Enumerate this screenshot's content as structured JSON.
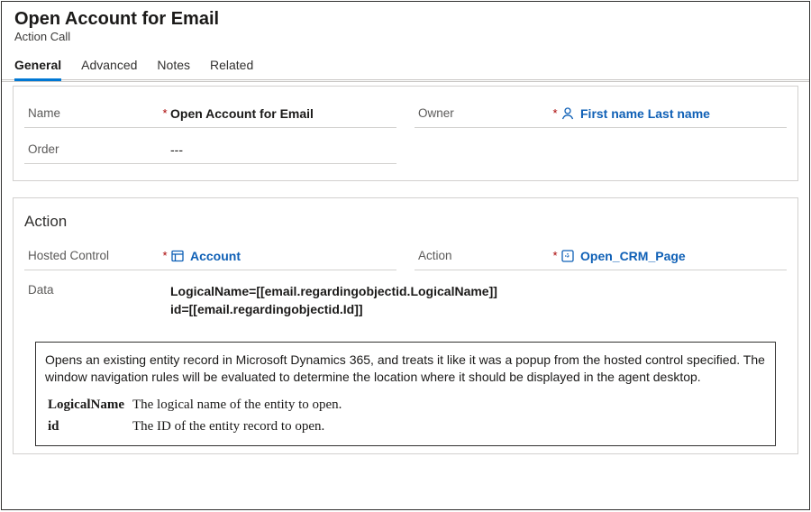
{
  "header": {
    "title": "Open Account for Email",
    "subtitle": "Action Call"
  },
  "tabs": {
    "general": "General",
    "advanced": "Advanced",
    "notes": "Notes",
    "related": "Related"
  },
  "fields": {
    "name_label": "Name",
    "name_value": "Open Account for Email",
    "owner_label": "Owner",
    "owner_value": "First name Last name",
    "order_label": "Order",
    "order_value": "---"
  },
  "action": {
    "section_title": "Action",
    "hosted_control_label": "Hosted Control",
    "hosted_control_value": "Account",
    "action_label": "Action",
    "action_value": "Open_CRM_Page",
    "data_label": "Data",
    "data_value": "LogicalName=[[email.regardingobjectid.LogicalName]]\nid=[[email.regardingobjectid.Id]]"
  },
  "doc": {
    "desc": "Opens an existing entity record in Microsoft Dynamics 365, and treats it like it was a popup from the hosted control specified.   The window navigation rules will be evaluated to determine the location where it should be displayed in the agent desktop.",
    "param1_name": "LogicalName",
    "param1_desc": "The logical name of the entity to open.",
    "param2_name": "id",
    "param2_desc": "The ID of the entity record to open."
  }
}
